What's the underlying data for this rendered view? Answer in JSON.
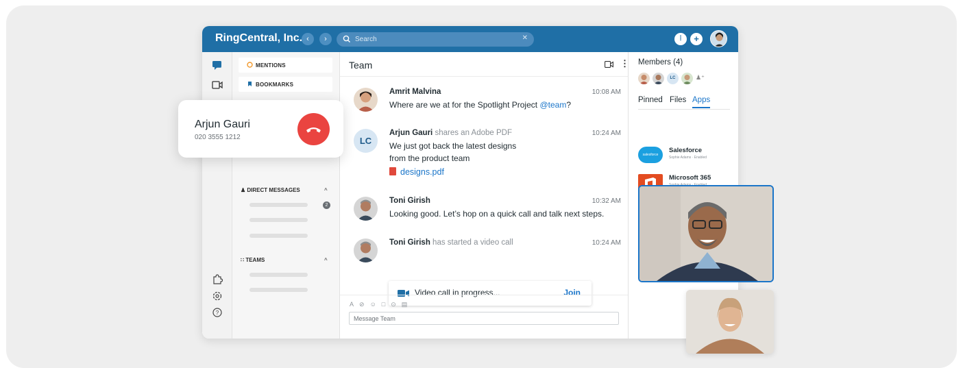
{
  "window": {
    "brand": "RingCentral, Inc.",
    "search_placeholder": "Search",
    "accent": "#1f6fa6"
  },
  "sidebar": {
    "mentions": "MENTIONS",
    "bookmarks": "BOOKMARKS",
    "direct_messages": "DIRECT MESSAGES",
    "dm_badge": "2",
    "teams": "TEAMS"
  },
  "incoming_call": {
    "name": "Arjun Gauri",
    "number": "020 3555 1212"
  },
  "conversation": {
    "title": "Team",
    "messages": [
      {
        "author": "Amrit Malvina",
        "action": "",
        "time": "10:08 AM",
        "text": "Where are we at for the Spotlight Project ",
        "mention": "@team",
        "suffix": "?"
      },
      {
        "author": "Arjun Gauri",
        "action": "shares an Adobe PDF",
        "time": "10:24 AM",
        "line1": "We just got back the latest designs",
        "line2": "from the product team",
        "file": "designs.pdf",
        "initials": "LC"
      },
      {
        "author": "Toni Girish",
        "action": "",
        "time": "10:32 AM",
        "text": "Looking good. Let’s hop on a quick call and talk next steps."
      },
      {
        "author": "Toni Girish",
        "action": "has started a video call",
        "time": "10:24 AM"
      }
    ],
    "video_call": {
      "status": "Video call in progress...",
      "join_label": "Join"
    },
    "composer_placeholder": "Message Team"
  },
  "details": {
    "members_label": "Members (4)",
    "member_initials": "LC",
    "tabs": [
      "Pinned",
      "Files",
      "Apps"
    ],
    "active_tab": "Apps",
    "apps": [
      {
        "name": "Salesforce",
        "sub": "Sophie Adams · Enabled",
        "logo_text": "salesforce"
      },
      {
        "name": "Microsoft 365",
        "sub": "Sophie Adams · Enabled"
      }
    ]
  }
}
